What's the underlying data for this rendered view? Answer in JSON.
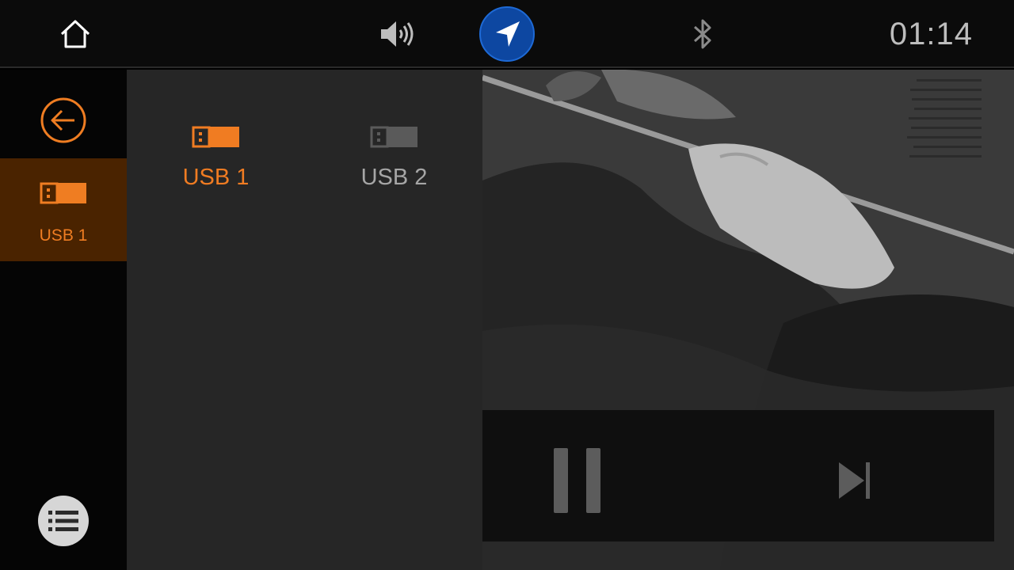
{
  "status_bar": {
    "clock": "01:14",
    "icons": [
      "home-icon",
      "volume-icon",
      "navigation-icon",
      "bluetooth-icon"
    ],
    "nav_button_color": "#0d47a1"
  },
  "rail": {
    "icons": [
      "back-arrow-icon",
      "usb-icon",
      "list-icon"
    ],
    "active_source_label": "USB 1"
  },
  "sources": [
    {
      "label": "USB 1",
      "selected": true,
      "icon": "usb-icon",
      "color": "#f07c22"
    },
    {
      "label": "USB 2",
      "selected": false,
      "icon": "usb-icon",
      "color": "#a6a6a6"
    }
  ],
  "player": {
    "state": "playing",
    "controls": [
      "pause-icon",
      "skip-next-icon"
    ]
  },
  "colors": {
    "accent": "#ef7d22",
    "active_tile": "#4a2300",
    "panel": "#262626"
  }
}
